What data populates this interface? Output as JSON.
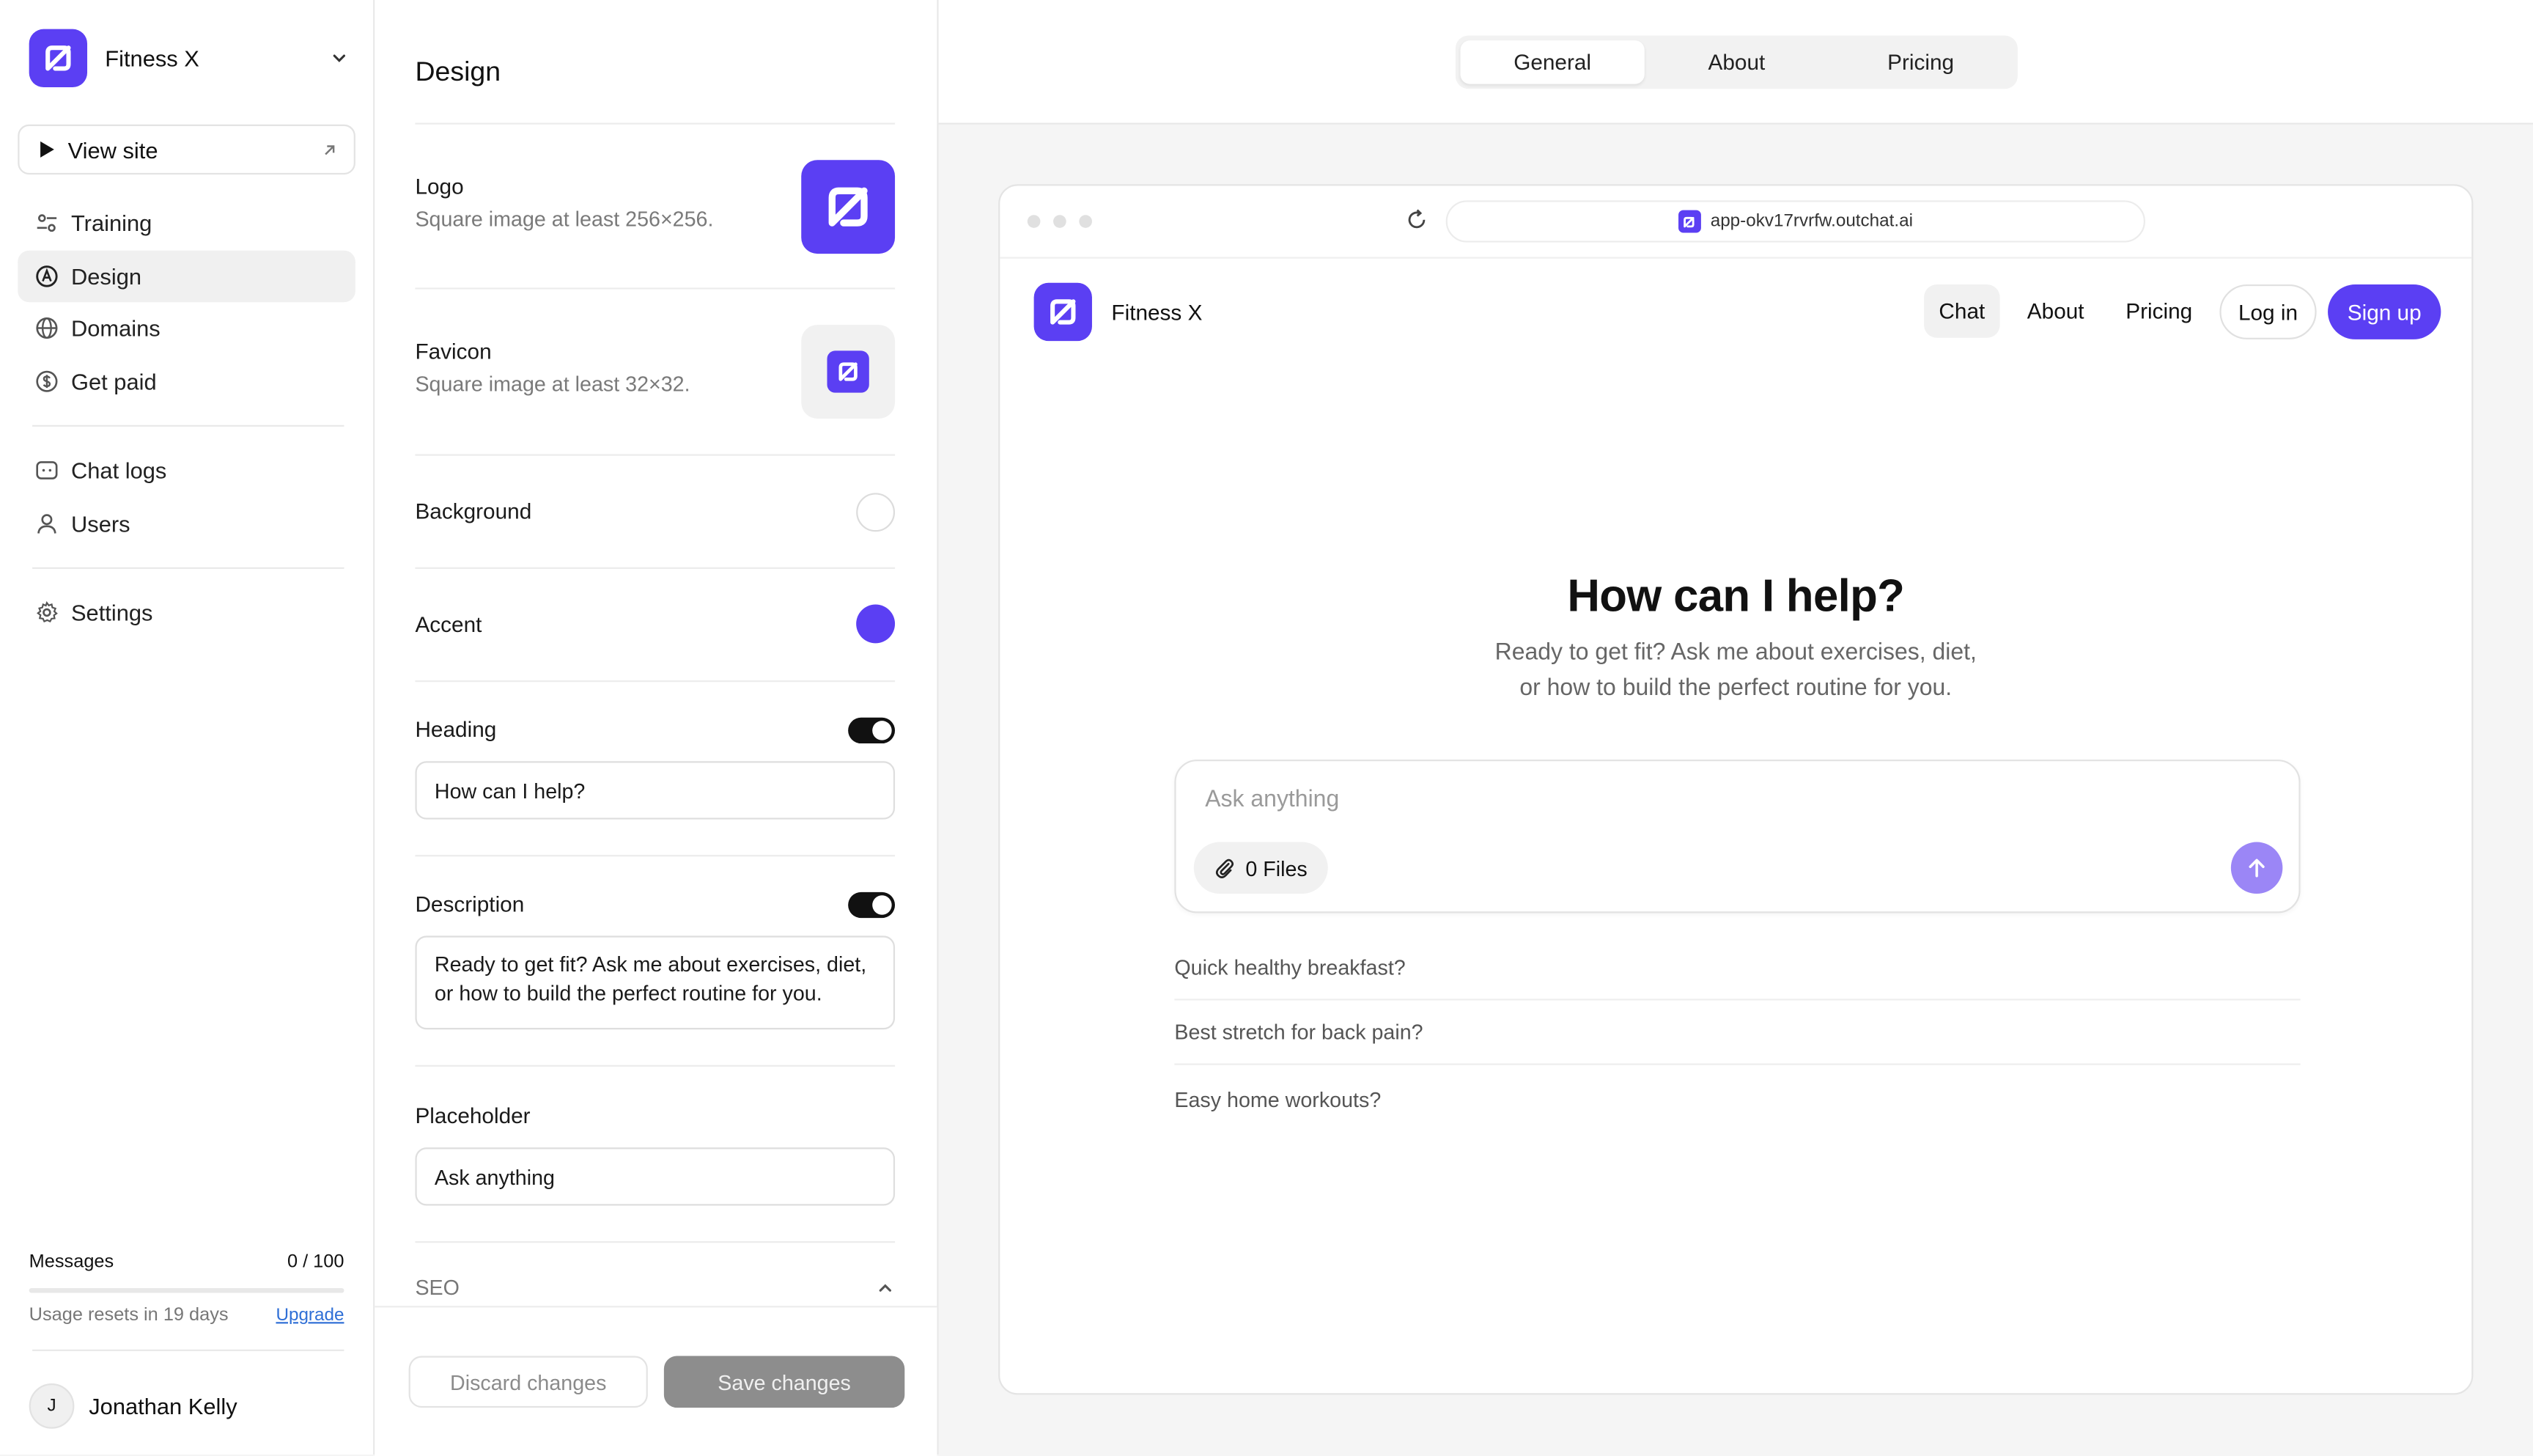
{
  "workspace": {
    "name": "Fitness X"
  },
  "sidebar": {
    "view_site": "View site",
    "items": [
      {
        "label": "Training"
      },
      {
        "label": "Design"
      },
      {
        "label": "Domains"
      },
      {
        "label": "Get paid"
      },
      {
        "label": "Chat logs"
      },
      {
        "label": "Users"
      },
      {
        "label": "Settings"
      }
    ],
    "usage": {
      "label": "Messages",
      "count": "0 / 100",
      "used_fraction": 0,
      "reset_text": "Usage resets in 19 days",
      "upgrade": "Upgrade"
    },
    "user": {
      "name": "Jonathan Kelly",
      "initial": "J"
    }
  },
  "design": {
    "title": "Design",
    "logo": {
      "label": "Logo",
      "hint": "Square image at least 256×256."
    },
    "favicon": {
      "label": "Favicon",
      "hint": "Square image at least 32×32."
    },
    "background": {
      "label": "Background",
      "color": "#ffffff"
    },
    "accent": {
      "label": "Accent",
      "color": "#5b3ff3"
    },
    "heading": {
      "label": "Heading",
      "enabled": true,
      "value": "How can I help?"
    },
    "description": {
      "label": "Description",
      "enabled": true,
      "value": "Ready to get fit? Ask me about exercises, diet, or how to build the perfect routine for you."
    },
    "placeholder": {
      "label": "Placeholder",
      "value": "Ask anything"
    },
    "seo": {
      "label": "SEO"
    },
    "discard": "Discard changes",
    "save": "Save changes"
  },
  "preview": {
    "tabs": [
      "General",
      "About",
      "Pricing"
    ],
    "url": "app-okv17rvrfw.outchat.ai",
    "site": {
      "brand": "Fitness X",
      "nav": {
        "chat": "Chat",
        "about": "About",
        "pricing": "Pricing",
        "login": "Log in",
        "signup": "Sign up"
      },
      "heading": "How can I help?",
      "desc_line1": "Ready to get fit? Ask me about exercises, diet,",
      "desc_line2": "or how to build the perfect routine for you.",
      "input_placeholder": "Ask anything",
      "files": "0 Files",
      "suggestions": [
        "Quick healthy breakfast?",
        "Best stretch for back pain?",
        "Easy home workouts?"
      ]
    }
  },
  "colors": {
    "accent": "#5b3ff3",
    "send_button": "#9b86f6",
    "save_disabled": "#8d8d8d"
  }
}
